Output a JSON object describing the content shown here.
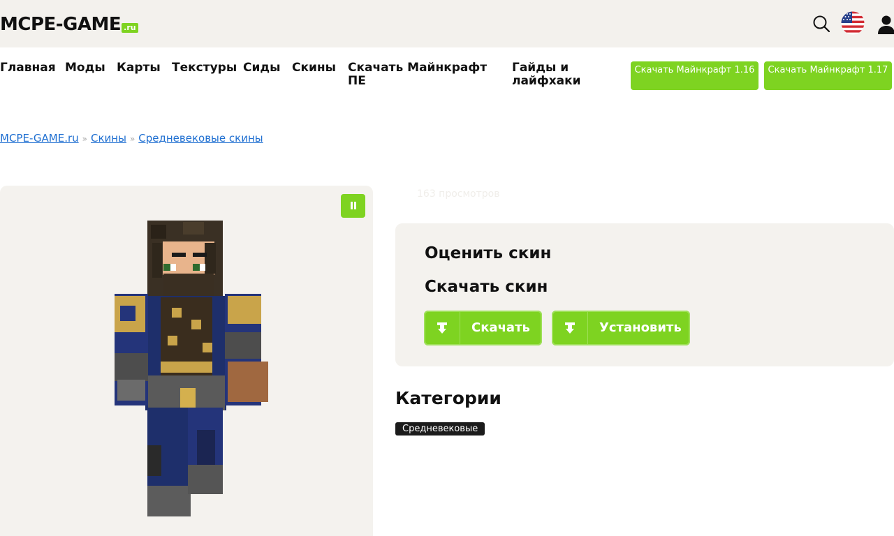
{
  "header": {
    "logo_text": "MCPE-GAME",
    "logo_suffix": ".ru",
    "icons": [
      "search-icon",
      "us-flag-icon",
      "user-icon"
    ]
  },
  "nav": {
    "items": [
      "Главная",
      "Моды",
      "Карты",
      "Текстуры",
      "Сиды",
      "Скины",
      "Скачать Майнкрафт ПЕ",
      "Гайды и лайфхаки"
    ],
    "buttons": [
      "Скачать Майнкрафт 1.16",
      "Скачать Майнкрафт 1.17"
    ]
  },
  "breadcrumb": [
    "MCPE-GAME.ru",
    "Скины",
    "Средневековые скины"
  ],
  "breadcrumb_sep": "»",
  "skin": {
    "views": "163 просмотров",
    "rate_heading": "Оценить скин",
    "download_heading": "Скачать скин",
    "download_button": "Скачать",
    "install_button": "Установить"
  },
  "categories": {
    "heading": "Категории",
    "tags": [
      "Средневековые"
    ]
  },
  "colors": {
    "accent": "#7ed321",
    "panel": "#f4f2ee",
    "link": "#1f6fd1"
  }
}
